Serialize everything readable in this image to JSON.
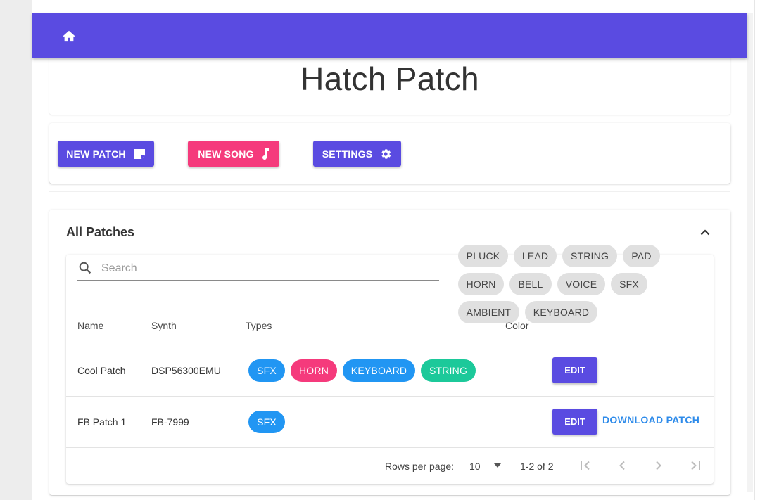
{
  "app": {
    "title": "Hatch Patch"
  },
  "toolbar": {
    "new_patch_label": "NEW PATCH",
    "new_song_label": "NEW SONG",
    "settings_label": "SETTINGS"
  },
  "patches": {
    "section_title": "All Patches",
    "search_placeholder": "Search",
    "filter_chips": [
      "PLUCK",
      "LEAD",
      "STRING",
      "PAD",
      "HORN",
      "BELL",
      "VOICE",
      "SFX",
      "AMBIENT",
      "KEYBOARD"
    ],
    "columns": [
      "Name",
      "Synth",
      "Types",
      "Color"
    ],
    "rows": [
      {
        "name": "Cool Patch",
        "synth": "DSP56300EMU",
        "types": [
          "SFX",
          "HORN",
          "KEYBOARD",
          "STRING"
        ],
        "edit_label": "EDIT"
      },
      {
        "name": "FB Patch 1",
        "synth": "FB-7999",
        "types": [
          "SFX"
        ],
        "edit_label": "EDIT",
        "download_label": "DOWNLOAD PATCH"
      }
    ],
    "pagination": {
      "rows_per_page_label": "Rows per page:",
      "rows_per_page_value": "10",
      "range_label": "1-2 of 2"
    }
  },
  "colors": {
    "primary": "#5a4be1",
    "secondary": "#f53a7c",
    "chip_sfx": "#2196f3",
    "chip_horn": "#f53a7c",
    "chip_keyboard": "#2196f3",
    "chip_string": "#1cc99a",
    "link": "#2e8bea"
  },
  "icons": {
    "home": "home-icon",
    "new_patch": "note-icon",
    "new_song": "music-note-icon",
    "settings": "gear-icon",
    "collapse": "chevron-up-icon",
    "search": "search-icon",
    "dropdown": "caret-down-icon",
    "first_page": "first-page-icon",
    "prev_page": "chevron-left-icon",
    "next_page": "chevron-right-icon",
    "last_page": "last-page-icon"
  }
}
